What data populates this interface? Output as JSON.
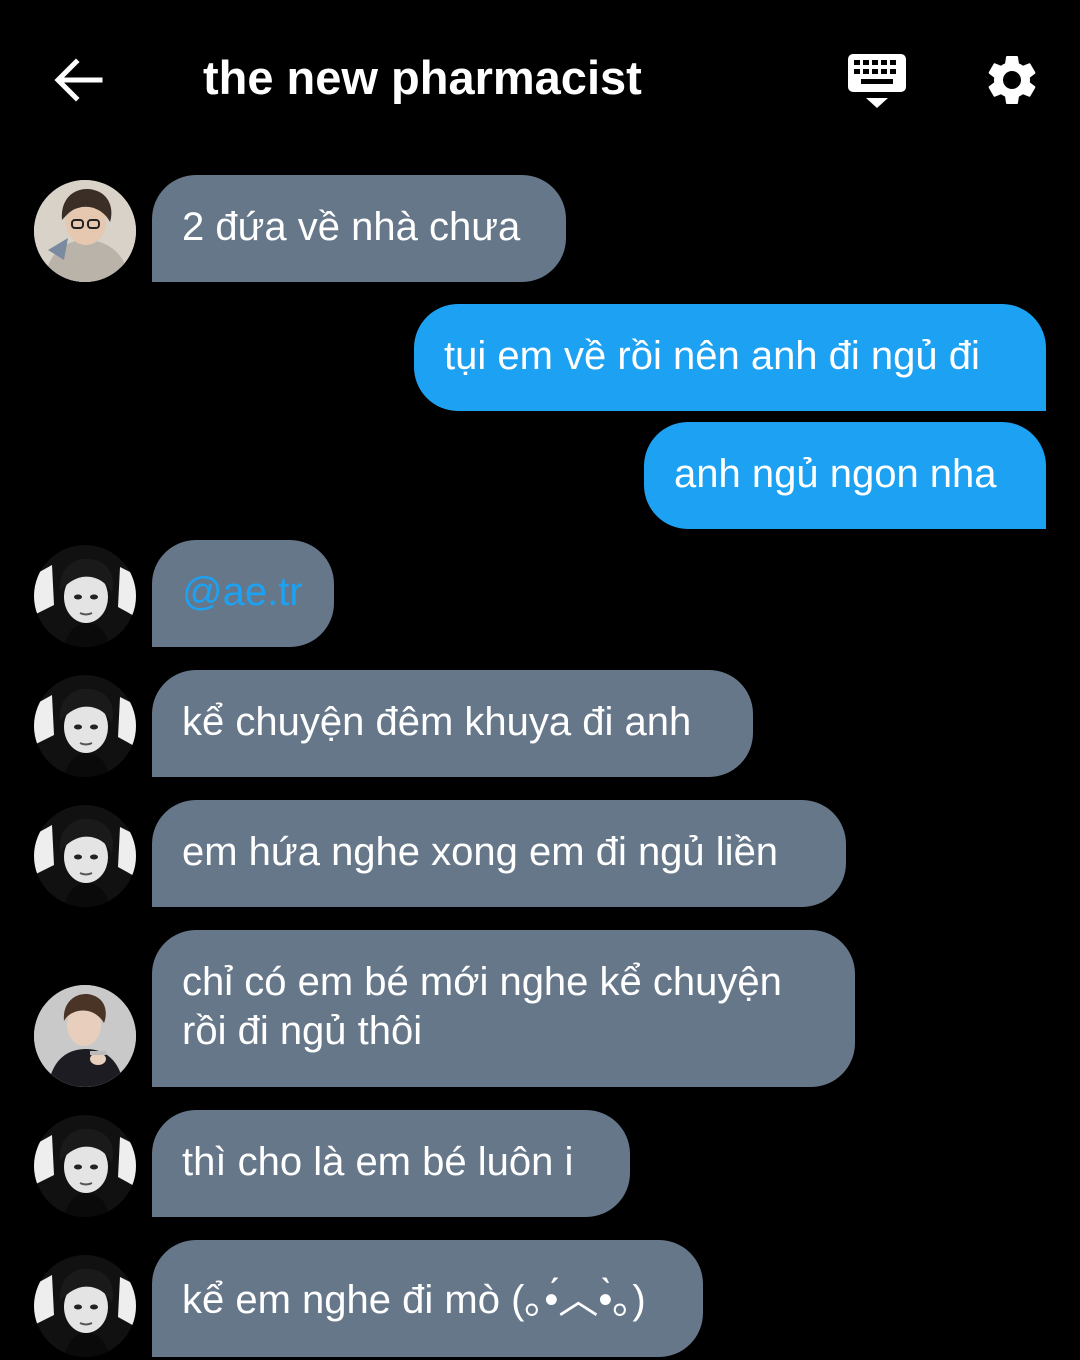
{
  "header": {
    "title": "the new pharmacist",
    "back_icon": "arrow-left-icon",
    "keyboard_icon": "keyboard-icon",
    "settings_icon": "gear-icon"
  },
  "colors": {
    "background": "#000000",
    "incoming_bubble": "#66778a",
    "outgoing_bubble": "#1da1f2",
    "mention": "#1da1f2",
    "text": "#ffffff"
  },
  "messages": [
    {
      "direction": "in",
      "avatar": "avatar-user-1",
      "text": "2 đứa về nhà chưa"
    },
    {
      "direction": "out",
      "text": "tụi em về rồi nên anh đi ngủ đi"
    },
    {
      "direction": "out",
      "text": "anh ngủ ngon nha"
    },
    {
      "direction": "in",
      "avatar": "avatar-user-2",
      "text": "@ae.tr"
    },
    {
      "direction": "in",
      "avatar": "avatar-user-2",
      "text": "kể chuyện đêm khuya đi anh"
    },
    {
      "direction": "in",
      "avatar": "avatar-user-2",
      "text": "em hứa nghe xong em đi ngủ liền"
    },
    {
      "direction": "in",
      "avatar": "avatar-user-3",
      "line1": "chỉ có em bé mới nghe kể chuyện",
      "line2": "rồi đi ngủ thôi"
    },
    {
      "direction": "in",
      "avatar": "avatar-user-2",
      "text": "thì cho là em bé luôn i"
    },
    {
      "direction": "in",
      "avatar": "avatar-user-2",
      "text": "kể em nghe đi mò (｡•́︿•̀｡)"
    }
  ]
}
